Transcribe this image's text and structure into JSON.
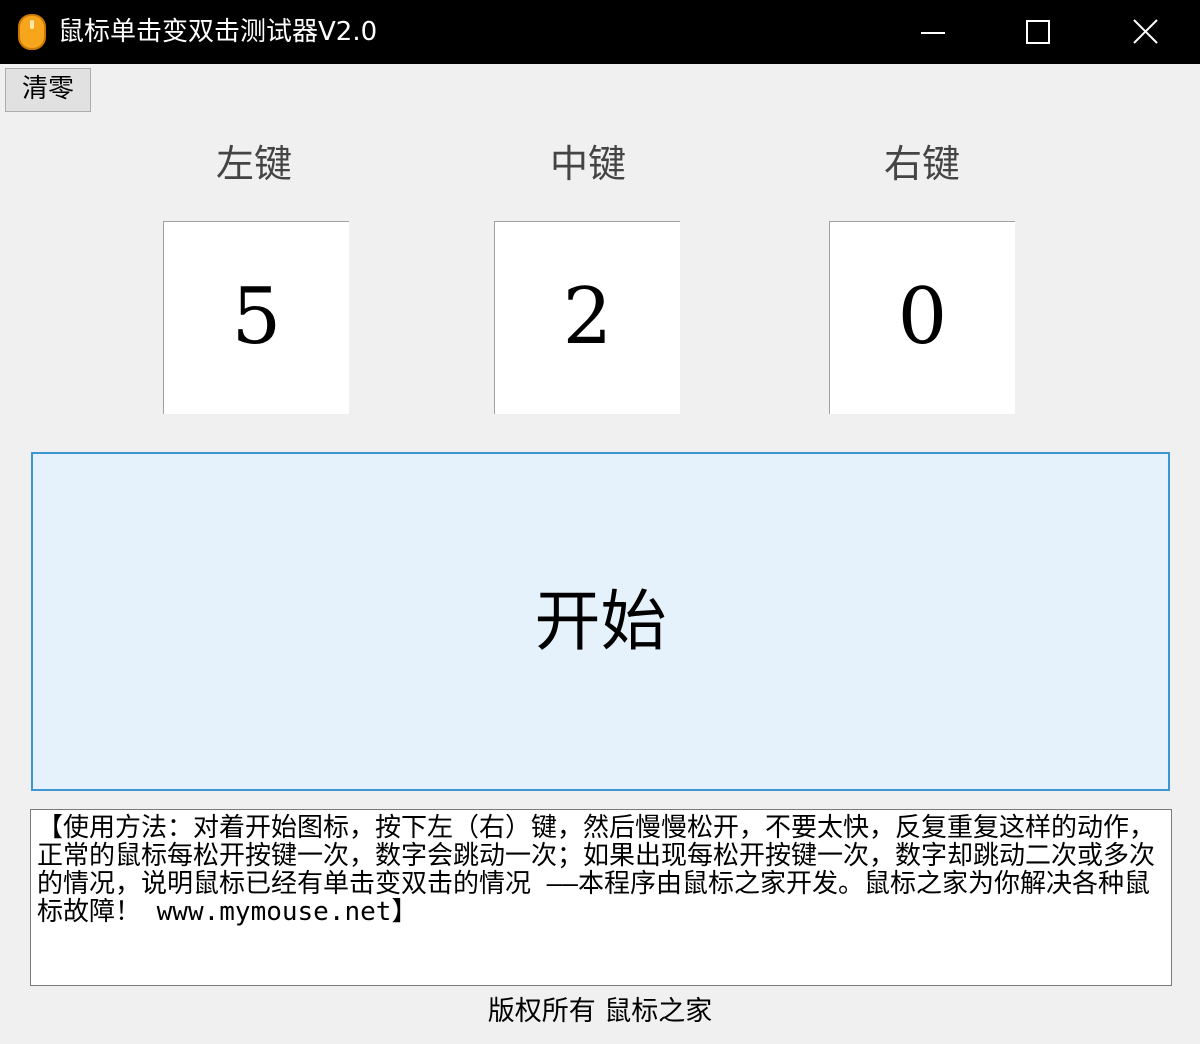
{
  "window": {
    "title": "鼠标单击变双击测试器V2.0",
    "icon": "mouse-icon",
    "controls": {
      "minimize_icon": "minimize-icon",
      "maximize_icon": "maximize-icon",
      "close_icon": "close-icon"
    }
  },
  "toolbar": {
    "clear_label": "清零"
  },
  "buttons": {
    "left": {
      "label": "左键",
      "count": "5"
    },
    "middle": {
      "label": "中键",
      "count": "2"
    },
    "right": {
      "label": "右键",
      "count": "0"
    }
  },
  "start_area": {
    "label": "开始"
  },
  "instructions": {
    "text": "【使用方法：对着开始图标，按下左（右）键，然后慢慢松开，不要太快，反复重复这样的动作，正常的鼠标每松开按键一次，数字会跳动一次；如果出现每松开按键一次，数字却跳动二次或多次的情况，说明鼠标已经有单击变双击的情况 ——本程序由鼠标之家开发。鼠标之家为你解决各种鼠标故障！ www.mymouse.net】"
  },
  "footer": {
    "copyright": "版权所有 鼠标之家"
  },
  "colors": {
    "titlebar_bg": "#000000",
    "window_bg": "#f0f0f0",
    "start_bg": "#e5f1fb",
    "start_border": "#3c96d2",
    "label_gray": "#444444"
  }
}
